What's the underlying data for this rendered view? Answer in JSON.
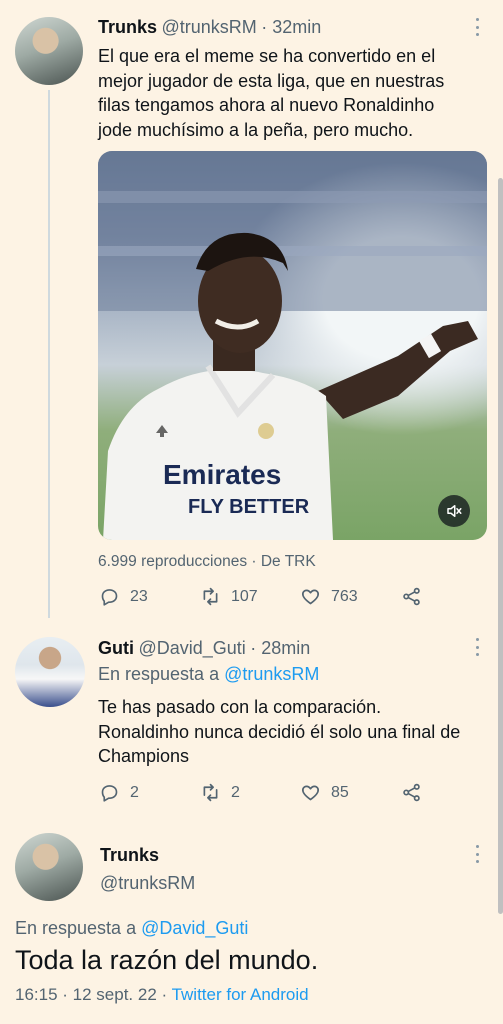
{
  "tweet1": {
    "name": "Trunks",
    "handle": "@trunksRM",
    "time": "· 32min",
    "text_lines": [
      "El que era el meme se ha convertido en el",
      "mejor jugador de esta liga, que en nuestras",
      "filas tengamos ahora al nuevo Ronaldinho",
      "jode muchísimo a la peña, pero mucho."
    ],
    "media": {
      "shirt_sponsor_line1": "Emirates",
      "shirt_sponsor_line2": "FLY BETTER"
    },
    "views": "6.999 reproducciones",
    "source": "· De TRK",
    "replies": "23",
    "retweets": "107",
    "likes": "763"
  },
  "tweet2": {
    "name": "Guti",
    "handle": "@David_Guti",
    "time": "· 28min",
    "reply_prefix": "En respuesta a",
    "reply_to": "@trunksRM",
    "text_lines": [
      "Te has pasado con la comparación.",
      "Ronaldinho nunca decidió él solo una final de",
      "Champions"
    ],
    "replies": "2",
    "retweets": "2",
    "likes": "85"
  },
  "tweet3": {
    "name": "Trunks",
    "handle": "@trunksRM",
    "reply_prefix": "En respuesta a",
    "reply_to": "@David_Guti",
    "text": "Toda la razón del mundo.",
    "date": "16:15 · 12 sept. 22 ·",
    "client": "Twitter for Android"
  },
  "colors": {
    "background": "#fdf3e4",
    "link": "#1d9bf0",
    "muted": "#536471"
  }
}
